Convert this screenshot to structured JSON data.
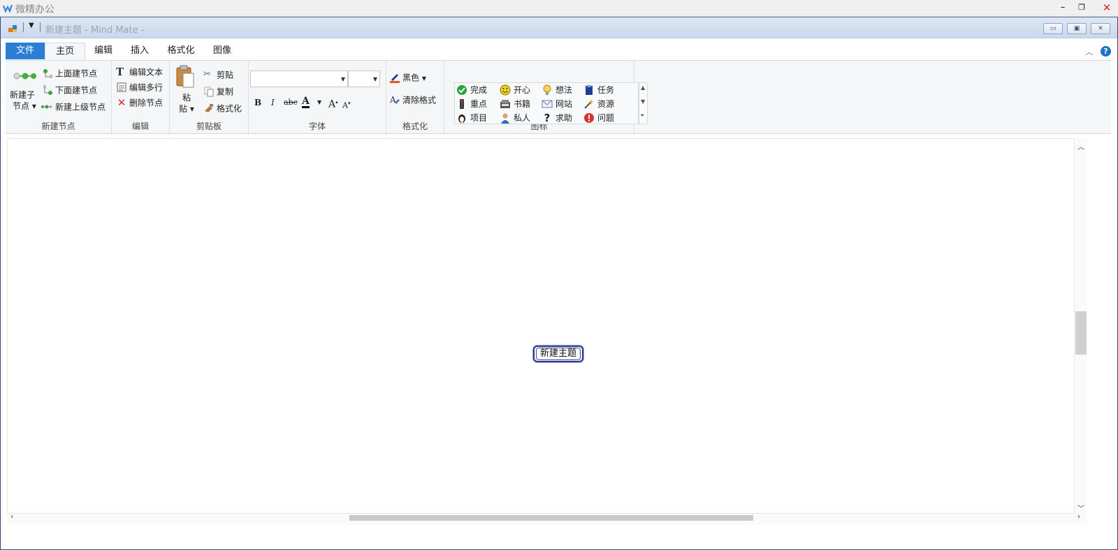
{
  "app": {
    "title": "微精办公"
  },
  "document": {
    "title": "新建主题 - Mind Mate -"
  },
  "tabs": [
    {
      "label": "文件"
    },
    {
      "label": "主页"
    },
    {
      "label": "编辑"
    },
    {
      "label": "插入"
    },
    {
      "label": "格式化"
    },
    {
      "label": "图像"
    }
  ],
  "ribbon": {
    "new_node": {
      "label": "新建节点",
      "child_line1": "新建子",
      "child_line2": "节点",
      "above": "上面建节点",
      "below": "下面建节点",
      "parent": "新建上级节点"
    },
    "edit": {
      "label": "编辑",
      "edit_text": "编辑文本",
      "edit_multiline": "编辑多行",
      "delete_node": "删除节点"
    },
    "clipboard": {
      "label": "剪贴板",
      "paste_line1": "粘",
      "paste_line2": "贴",
      "cut": "剪贴",
      "copy": "复制",
      "format_painter": "格式化"
    },
    "font": {
      "label": "字体",
      "font_name": "",
      "font_size": "",
      "bold": "B",
      "italic": "I",
      "strike": "abc",
      "color": "A",
      "grow": "A",
      "shrink": "A"
    },
    "format": {
      "label": "格式化",
      "color": "黑色",
      "clear": "清除格式"
    },
    "icons": {
      "label": "图标",
      "items": [
        {
          "label": "完成",
          "icon": "check-icon",
          "color": "#27a33a"
        },
        {
          "label": "开心",
          "icon": "smiley-icon",
          "color": "#e8c21a"
        },
        {
          "label": "想法",
          "icon": "lightbulb-icon",
          "color": "#f0b32a"
        },
        {
          "label": "任务",
          "icon": "task-book-icon",
          "color": "#1f3f8f"
        },
        {
          "label": "重点",
          "icon": "traffic-light-icon",
          "color": "#c81e1e"
        },
        {
          "label": "书籍",
          "icon": "book-icon",
          "color": "#555555"
        },
        {
          "label": "网站",
          "icon": "envelope-icon",
          "color": "#6b7fa8"
        },
        {
          "label": "资源",
          "icon": "wand-icon",
          "color": "#d99a16"
        },
        {
          "label": "项目",
          "icon": "penguin-icon",
          "color": "#222222"
        },
        {
          "label": "私人",
          "icon": "person-icon",
          "color": "#2a6fb7"
        },
        {
          "label": "求助",
          "icon": "question-icon",
          "color": "#222222"
        },
        {
          "label": "问题",
          "icon": "alert-icon",
          "color": "#d9342b"
        }
      ]
    }
  },
  "canvas": {
    "central_topic": "新建主题"
  },
  "colors": {
    "file_tab": "#2a7fd4",
    "accent": "#1e72c8",
    "close": "#d8262a"
  }
}
